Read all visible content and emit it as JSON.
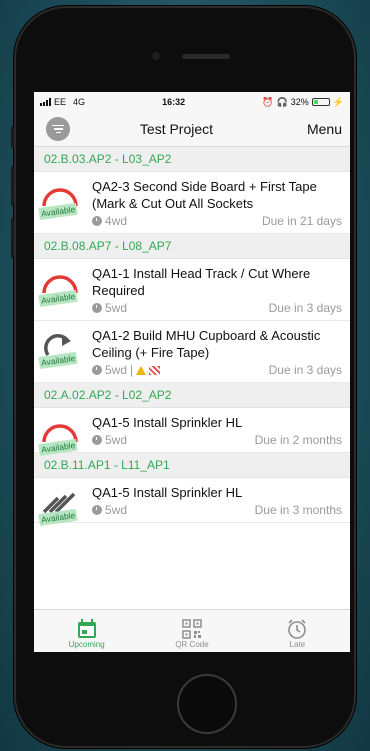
{
  "status_bar": {
    "carrier": "EE",
    "network": "4G",
    "time": "16:32",
    "battery_percent": "32%",
    "battery_level": 0.32
  },
  "nav": {
    "title": "Test Project",
    "menu_label": "Menu"
  },
  "sections": [
    {
      "header": "02.B.03.AP2 - L03_AP2",
      "tasks": [
        {
          "title": "QA2-3 Second Side Board + First Tape (Mark & Cut Out All Sockets",
          "duration": "4wd",
          "due": "Due in 21 days",
          "badge": "Available",
          "icon": "red-arc-icon"
        }
      ]
    },
    {
      "header": "02.B.08.AP7 - L08_AP7",
      "tasks": [
        {
          "title": "QA1-1 Install Head Track / Cut Where Required",
          "duration": "5wd",
          "due": "Due in 3 days",
          "badge": "Available",
          "icon": "red-arc-icon"
        },
        {
          "title": "QA1-2 Build MHU Cupboard & Acoustic Ceiling (+ Fire Tape)",
          "duration": "5wd",
          "due": "Due in 3 days",
          "badge": "Available",
          "icon": "redo-arrow-icon",
          "separator": "|"
        }
      ]
    },
    {
      "header": "02.A.02.AP2 - L02_AP2",
      "tasks": [
        {
          "title": "QA1-5 Install Sprinkler HL",
          "duration": "5wd",
          "due": "Due in 2 months",
          "badge": "Available",
          "icon": "red-arc-icon"
        }
      ]
    },
    {
      "header": "02.B.11.AP1 - L11_AP1",
      "tasks": [
        {
          "title": "QA1-5 Install Sprinkler HL",
          "duration": "5wd",
          "due": "Due in 3 months",
          "badge": "Available",
          "icon": "hatched-stripes-icon"
        }
      ]
    }
  ],
  "tabbar": {
    "tabs": [
      {
        "label": "Upcoming",
        "icon": "calendar-icon"
      },
      {
        "label": "QR Code",
        "icon": "qr-code-icon"
      },
      {
        "label": "Late",
        "icon": "alarm-clock-icon"
      }
    ]
  },
  "colors": {
    "accent": "#33a852",
    "danger": "#e53935",
    "badge_bg": "#b8e6c3"
  }
}
